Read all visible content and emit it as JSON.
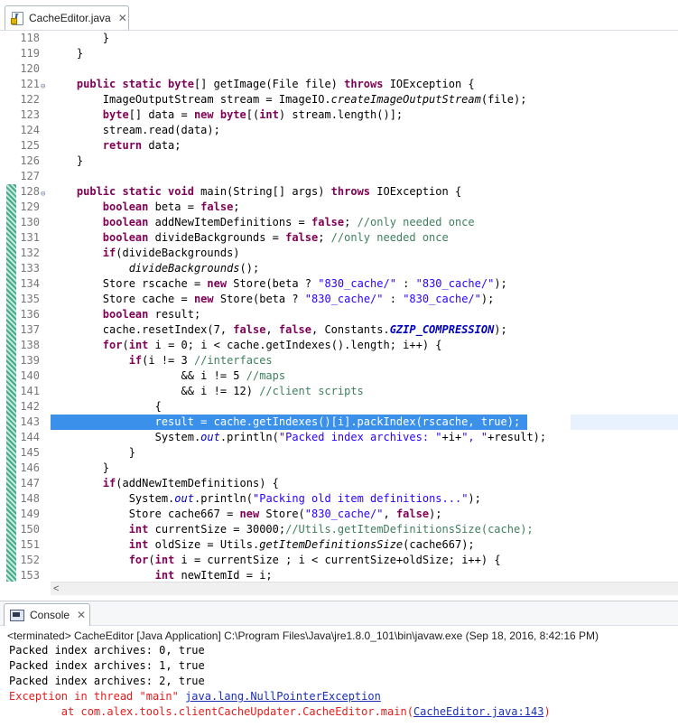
{
  "editor_tab": {
    "file": "CacheEditor.java",
    "close": "✕"
  },
  "code_lines": [
    {
      "n": "118",
      "fold": false,
      "hl": false,
      "chg": false,
      "t": [
        {
          "c": "p",
          "v": "        }"
        }
      ]
    },
    {
      "n": "119",
      "fold": false,
      "hl": false,
      "chg": false,
      "t": [
        {
          "c": "p",
          "v": "    }"
        }
      ]
    },
    {
      "n": "120",
      "fold": false,
      "hl": false,
      "chg": false,
      "t": []
    },
    {
      "n": "121",
      "fold": true,
      "hl": false,
      "chg": false,
      "t": [
        {
          "c": "p",
          "v": "    "
        },
        {
          "c": "kw",
          "v": "public static byte"
        },
        {
          "c": "p",
          "v": "[] getImage(File file) "
        },
        {
          "c": "kw",
          "v": "throws"
        },
        {
          "c": "p",
          "v": " IOException {"
        }
      ]
    },
    {
      "n": "122",
      "fold": false,
      "hl": false,
      "chg": false,
      "t": [
        {
          "c": "p",
          "v": "        ImageOutputStream stream = ImageIO."
        },
        {
          "c": "it",
          "v": "createImageOutputStream"
        },
        {
          "c": "p",
          "v": "(file);"
        }
      ]
    },
    {
      "n": "123",
      "fold": false,
      "hl": false,
      "chg": false,
      "t": [
        {
          "c": "p",
          "v": "        "
        },
        {
          "c": "kw",
          "v": "byte"
        },
        {
          "c": "p",
          "v": "[] data = "
        },
        {
          "c": "kw",
          "v": "new byte"
        },
        {
          "c": "p",
          "v": "[("
        },
        {
          "c": "kw",
          "v": "int"
        },
        {
          "c": "p",
          "v": ") stream.length()];"
        }
      ]
    },
    {
      "n": "124",
      "fold": false,
      "hl": false,
      "chg": false,
      "t": [
        {
          "c": "p",
          "v": "        stream.read(data);"
        }
      ]
    },
    {
      "n": "125",
      "fold": false,
      "hl": false,
      "chg": false,
      "t": [
        {
          "c": "p",
          "v": "        "
        },
        {
          "c": "kw",
          "v": "return"
        },
        {
          "c": "p",
          "v": " data;"
        }
      ]
    },
    {
      "n": "126",
      "fold": false,
      "hl": false,
      "chg": false,
      "t": [
        {
          "c": "p",
          "v": "    }"
        }
      ]
    },
    {
      "n": "127",
      "fold": false,
      "hl": false,
      "chg": false,
      "t": []
    },
    {
      "n": "128",
      "fold": true,
      "hl": false,
      "chg": true,
      "t": [
        {
          "c": "p",
          "v": "    "
        },
        {
          "c": "kw",
          "v": "public static void"
        },
        {
          "c": "p",
          "v": " main(String[] args) "
        },
        {
          "c": "kw",
          "v": "throws"
        },
        {
          "c": "p",
          "v": " IOException {"
        }
      ]
    },
    {
      "n": "129",
      "fold": false,
      "hl": false,
      "chg": true,
      "t": [
        {
          "c": "p",
          "v": "        "
        },
        {
          "c": "kw",
          "v": "boolean"
        },
        {
          "c": "p",
          "v": " beta = "
        },
        {
          "c": "kw",
          "v": "false"
        },
        {
          "c": "p",
          "v": ";"
        }
      ]
    },
    {
      "n": "130",
      "fold": false,
      "hl": false,
      "chg": true,
      "t": [
        {
          "c": "p",
          "v": "        "
        },
        {
          "c": "kw",
          "v": "boolean"
        },
        {
          "c": "p",
          "v": " addNewItemDefinitions = "
        },
        {
          "c": "kw",
          "v": "false"
        },
        {
          "c": "p",
          "v": "; "
        },
        {
          "c": "cm",
          "v": "//only needed once"
        }
      ]
    },
    {
      "n": "131",
      "fold": false,
      "hl": false,
      "chg": true,
      "t": [
        {
          "c": "p",
          "v": "        "
        },
        {
          "c": "kw",
          "v": "boolean"
        },
        {
          "c": "p",
          "v": " divideBackgrounds = "
        },
        {
          "c": "kw",
          "v": "false"
        },
        {
          "c": "p",
          "v": "; "
        },
        {
          "c": "cm",
          "v": "//only needed once"
        }
      ]
    },
    {
      "n": "132",
      "fold": false,
      "hl": false,
      "chg": true,
      "t": [
        {
          "c": "p",
          "v": "        "
        },
        {
          "c": "kw",
          "v": "if"
        },
        {
          "c": "p",
          "v": "(divideBackgrounds)"
        }
      ]
    },
    {
      "n": "133",
      "fold": false,
      "hl": false,
      "chg": true,
      "t": [
        {
          "c": "p",
          "v": "            "
        },
        {
          "c": "it",
          "v": "divideBackgrounds"
        },
        {
          "c": "p",
          "v": "();"
        }
      ]
    },
    {
      "n": "134",
      "fold": false,
      "hl": false,
      "chg": true,
      "t": [
        {
          "c": "p",
          "v": "        Store rscache = "
        },
        {
          "c": "kw",
          "v": "new"
        },
        {
          "c": "p",
          "v": " Store(beta ? "
        },
        {
          "c": "str",
          "v": "\"830_cache/\""
        },
        {
          "c": "p",
          "v": " : "
        },
        {
          "c": "str",
          "v": "\"830_cache/\""
        },
        {
          "c": "p",
          "v": ");"
        }
      ]
    },
    {
      "n": "135",
      "fold": false,
      "hl": false,
      "chg": true,
      "t": [
        {
          "c": "p",
          "v": "        Store cache = "
        },
        {
          "c": "kw",
          "v": "new"
        },
        {
          "c": "p",
          "v": " Store(beta ? "
        },
        {
          "c": "str",
          "v": "\"830_cache/\""
        },
        {
          "c": "p",
          "v": " : "
        },
        {
          "c": "str",
          "v": "\"830_cache/\""
        },
        {
          "c": "p",
          "v": ");"
        }
      ]
    },
    {
      "n": "136",
      "fold": false,
      "hl": false,
      "chg": true,
      "t": [
        {
          "c": "p",
          "v": "        "
        },
        {
          "c": "kw",
          "v": "boolean"
        },
        {
          "c": "p",
          "v": " result;"
        }
      ]
    },
    {
      "n": "137",
      "fold": false,
      "hl": false,
      "chg": true,
      "t": [
        {
          "c": "p",
          "v": "        cache.resetIndex(7, "
        },
        {
          "c": "kw",
          "v": "false"
        },
        {
          "c": "p",
          "v": ", "
        },
        {
          "c": "kw",
          "v": "false"
        },
        {
          "c": "p",
          "v": ", Constants."
        },
        {
          "c": "cst",
          "v": "GZIP_COMPRESSION"
        },
        {
          "c": "p",
          "v": ");"
        }
      ]
    },
    {
      "n": "138",
      "fold": false,
      "hl": false,
      "chg": true,
      "t": [
        {
          "c": "p",
          "v": "        "
        },
        {
          "c": "kw",
          "v": "for"
        },
        {
          "c": "p",
          "v": "("
        },
        {
          "c": "kw",
          "v": "int"
        },
        {
          "c": "p",
          "v": " i = 0; i < cache.getIndexes().length; i++) {"
        }
      ]
    },
    {
      "n": "139",
      "fold": false,
      "hl": false,
      "chg": true,
      "t": [
        {
          "c": "p",
          "v": "            "
        },
        {
          "c": "kw",
          "v": "if"
        },
        {
          "c": "p",
          "v": "(i != 3 "
        },
        {
          "c": "cm",
          "v": "//interfaces"
        }
      ]
    },
    {
      "n": "140",
      "fold": false,
      "hl": false,
      "chg": true,
      "t": [
        {
          "c": "p",
          "v": "                    && i != 5 "
        },
        {
          "c": "cm",
          "v": "//maps"
        }
      ]
    },
    {
      "n": "141",
      "fold": false,
      "hl": false,
      "chg": true,
      "t": [
        {
          "c": "p",
          "v": "                    && i != 12) "
        },
        {
          "c": "cm",
          "v": "//client scripts"
        }
      ]
    },
    {
      "n": "142",
      "fold": false,
      "hl": false,
      "chg": true,
      "t": [
        {
          "c": "p",
          "v": "                {"
        }
      ]
    },
    {
      "n": "143",
      "fold": false,
      "hl": true,
      "chg": true,
      "t": [
        {
          "c": "p",
          "v": "                result = cache.getIndexes()[i].packIndex(rscache, true);"
        }
      ]
    },
    {
      "n": "144",
      "fold": false,
      "hl": false,
      "chg": true,
      "t": [
        {
          "c": "p",
          "v": "                System."
        },
        {
          "c": "fld",
          "v": "out"
        },
        {
          "c": "p",
          "v": ".println("
        },
        {
          "c": "str",
          "v": "\"Packed index archives: \""
        },
        {
          "c": "p",
          "v": "+i+"
        },
        {
          "c": "str",
          "v": "\", \""
        },
        {
          "c": "p",
          "v": "+result);"
        }
      ]
    },
    {
      "n": "145",
      "fold": false,
      "hl": false,
      "chg": true,
      "t": [
        {
          "c": "p",
          "v": "            }"
        }
      ]
    },
    {
      "n": "146",
      "fold": false,
      "hl": false,
      "chg": true,
      "t": [
        {
          "c": "p",
          "v": "        }"
        }
      ]
    },
    {
      "n": "147",
      "fold": false,
      "hl": false,
      "chg": true,
      "t": [
        {
          "c": "p",
          "v": "        "
        },
        {
          "c": "kw",
          "v": "if"
        },
        {
          "c": "p",
          "v": "(addNewItemDefinitions) {"
        }
      ]
    },
    {
      "n": "148",
      "fold": false,
      "hl": false,
      "chg": true,
      "t": [
        {
          "c": "p",
          "v": "            System."
        },
        {
          "c": "fld",
          "v": "out"
        },
        {
          "c": "p",
          "v": ".println("
        },
        {
          "c": "str",
          "v": "\"Packing old item definitions...\""
        },
        {
          "c": "p",
          "v": ");"
        }
      ]
    },
    {
      "n": "149",
      "fold": false,
      "hl": false,
      "chg": true,
      "t": [
        {
          "c": "p",
          "v": "            Store cache667 = "
        },
        {
          "c": "kw",
          "v": "new"
        },
        {
          "c": "p",
          "v": " Store("
        },
        {
          "c": "str",
          "v": "\"830_cache/\""
        },
        {
          "c": "p",
          "v": ", "
        },
        {
          "c": "kw",
          "v": "false"
        },
        {
          "c": "p",
          "v": ");"
        }
      ]
    },
    {
      "n": "150",
      "fold": false,
      "hl": false,
      "chg": true,
      "t": [
        {
          "c": "p",
          "v": "            "
        },
        {
          "c": "kw",
          "v": "int"
        },
        {
          "c": "p",
          "v": " currentSize = 30000;"
        },
        {
          "c": "cm",
          "v": "//Utils.getItemDefinitionsSize(cache);"
        }
      ]
    },
    {
      "n": "151",
      "fold": false,
      "hl": false,
      "chg": true,
      "t": [
        {
          "c": "p",
          "v": "            "
        },
        {
          "c": "kw",
          "v": "int"
        },
        {
          "c": "p",
          "v": " oldSize = Utils."
        },
        {
          "c": "it",
          "v": "getItemDefinitionsSize"
        },
        {
          "c": "p",
          "v": "(cache667);"
        }
      ]
    },
    {
      "n": "152",
      "fold": false,
      "hl": false,
      "chg": true,
      "t": [
        {
          "c": "p",
          "v": "            "
        },
        {
          "c": "kw",
          "v": "for"
        },
        {
          "c": "p",
          "v": "("
        },
        {
          "c": "kw",
          "v": "int"
        },
        {
          "c": "p",
          "v": " i = currentSize ; i < currentSize+oldSize; i++) {"
        }
      ]
    },
    {
      "n": "153",
      "fold": false,
      "hl": false,
      "chg": true,
      "t": [
        {
          "c": "p",
          "v": "                "
        },
        {
          "c": "kw",
          "v": "int"
        },
        {
          "c": "p",
          "v": " newItemId = i;"
        }
      ]
    }
  ],
  "scroll_left_arrow": "<",
  "console": {
    "tab_label": "Console",
    "close": "✕",
    "status": "<terminated> CacheEditor [Java Application] C:\\Program Files\\Java\\jre1.8.0_101\\bin\\javaw.exe (Sep 18, 2016, 8:42:16 PM)",
    "lines": [
      {
        "type": "normal",
        "pre": "Packed index archives: 0, true",
        "link": "",
        "post": ""
      },
      {
        "type": "normal",
        "pre": "Packed index archives: 1, true",
        "link": "",
        "post": ""
      },
      {
        "type": "normal",
        "pre": "Packed index archives: 2, true",
        "link": "",
        "post": ""
      },
      {
        "type": "err",
        "pre": "Exception in thread \"main\" ",
        "link": "java.lang.NullPointerException",
        "post": ""
      },
      {
        "type": "err",
        "pre": "        at com.alex.tools.clientCacheUpdater.CacheEditor.main(",
        "link": "CacheEditor.java:143",
        "post": ")"
      }
    ]
  },
  "colors": {
    "keyword": "#7f0055",
    "string": "#2a00ff",
    "comment": "#3f7f5f",
    "highlight": "#3b90ea",
    "error": "#e51c1c",
    "link": "#1b2fb5"
  }
}
